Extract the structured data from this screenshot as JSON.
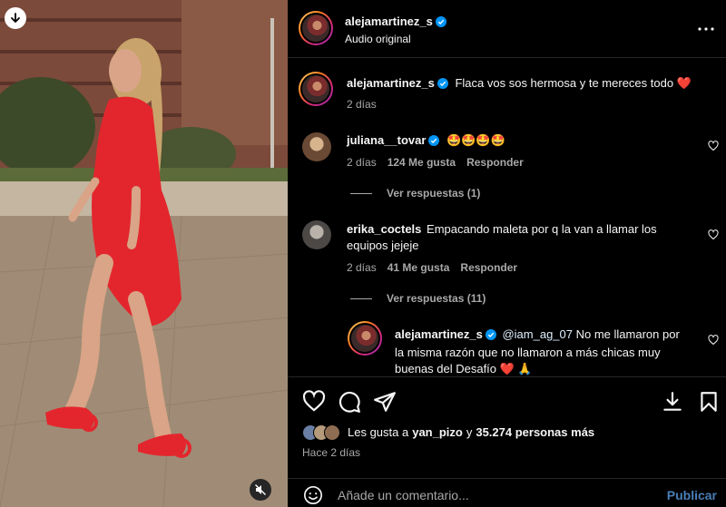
{
  "post": {
    "author": "alejamartinez_s",
    "audio": "Audio original"
  },
  "caption": {
    "author": "alejamartinez_s",
    "text": "Flaca vos sos hermosa y te mereces todo ❤️",
    "time": "2 días"
  },
  "comments": [
    {
      "author": "juliana__tovar",
      "text": "🤩🤩🤩🤩",
      "time": "2 días",
      "likes": "124 Me gusta",
      "reply": "Responder",
      "view_replies": "Ver respuestas (1)"
    },
    {
      "author": "erika_coctels",
      "text_line1": "Empacando maleta por q la van a llamar los",
      "text_line2": "equipos jejeje",
      "time": "2 días",
      "likes": "41 Me gusta",
      "reply": "Responder",
      "view_replies": "Ver respuestas (11)"
    }
  ],
  "reply": {
    "author": "alejamartinez_s",
    "mention": "@iam_ag_07",
    "line1": "No me llamaron por",
    "line2": "la misma razón que no llamaron a más chicas muy",
    "line3": "buenas del Desafío ❤️ 🙏"
  },
  "likes": {
    "prefix": "Les gusta a",
    "user": "yan_pizo",
    "connector": "y",
    "others": "35.274 personas más"
  },
  "posted": "Hace 2 días",
  "composer": {
    "placeholder": "Añade un comentario...",
    "publish": "Publicar"
  },
  "colors": {
    "verified": "#0095f6",
    "publish": "#4a7eb5",
    "heart": "#ff3040",
    "dress": "#e3262d"
  }
}
